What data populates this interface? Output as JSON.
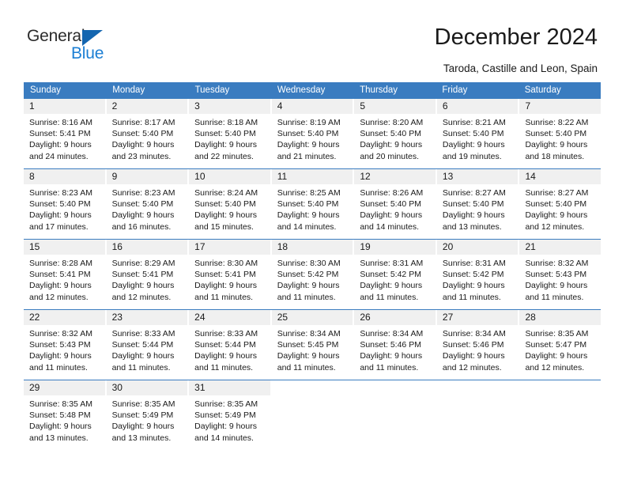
{
  "brand": {
    "name_top": "General",
    "name_bottom": "Blue",
    "accent_color": "#1c7fd4",
    "triangle_color": "#1466b0"
  },
  "header": {
    "title": "December 2024",
    "subtitle": "Taroda, Castille and Leon, Spain"
  },
  "calendar": {
    "header_bg": "#3a7cc0",
    "daynum_bg": "#f0f0f0",
    "weekdays": [
      "Sunday",
      "Monday",
      "Tuesday",
      "Wednesday",
      "Thursday",
      "Friday",
      "Saturday"
    ],
    "weeks": [
      [
        {
          "day": "1",
          "sunrise": "Sunrise: 8:16 AM",
          "sunset": "Sunset: 5:41 PM",
          "daylight1": "Daylight: 9 hours",
          "daylight2": "and 24 minutes."
        },
        {
          "day": "2",
          "sunrise": "Sunrise: 8:17 AM",
          "sunset": "Sunset: 5:40 PM",
          "daylight1": "Daylight: 9 hours",
          "daylight2": "and 23 minutes."
        },
        {
          "day": "3",
          "sunrise": "Sunrise: 8:18 AM",
          "sunset": "Sunset: 5:40 PM",
          "daylight1": "Daylight: 9 hours",
          "daylight2": "and 22 minutes."
        },
        {
          "day": "4",
          "sunrise": "Sunrise: 8:19 AM",
          "sunset": "Sunset: 5:40 PM",
          "daylight1": "Daylight: 9 hours",
          "daylight2": "and 21 minutes."
        },
        {
          "day": "5",
          "sunrise": "Sunrise: 8:20 AM",
          "sunset": "Sunset: 5:40 PM",
          "daylight1": "Daylight: 9 hours",
          "daylight2": "and 20 minutes."
        },
        {
          "day": "6",
          "sunrise": "Sunrise: 8:21 AM",
          "sunset": "Sunset: 5:40 PM",
          "daylight1": "Daylight: 9 hours",
          "daylight2": "and 19 minutes."
        },
        {
          "day": "7",
          "sunrise": "Sunrise: 8:22 AM",
          "sunset": "Sunset: 5:40 PM",
          "daylight1": "Daylight: 9 hours",
          "daylight2": "and 18 minutes."
        }
      ],
      [
        {
          "day": "8",
          "sunrise": "Sunrise: 8:23 AM",
          "sunset": "Sunset: 5:40 PM",
          "daylight1": "Daylight: 9 hours",
          "daylight2": "and 17 minutes."
        },
        {
          "day": "9",
          "sunrise": "Sunrise: 8:23 AM",
          "sunset": "Sunset: 5:40 PM",
          "daylight1": "Daylight: 9 hours",
          "daylight2": "and 16 minutes."
        },
        {
          "day": "10",
          "sunrise": "Sunrise: 8:24 AM",
          "sunset": "Sunset: 5:40 PM",
          "daylight1": "Daylight: 9 hours",
          "daylight2": "and 15 minutes."
        },
        {
          "day": "11",
          "sunrise": "Sunrise: 8:25 AM",
          "sunset": "Sunset: 5:40 PM",
          "daylight1": "Daylight: 9 hours",
          "daylight2": "and 14 minutes."
        },
        {
          "day": "12",
          "sunrise": "Sunrise: 8:26 AM",
          "sunset": "Sunset: 5:40 PM",
          "daylight1": "Daylight: 9 hours",
          "daylight2": "and 14 minutes."
        },
        {
          "day": "13",
          "sunrise": "Sunrise: 8:27 AM",
          "sunset": "Sunset: 5:40 PM",
          "daylight1": "Daylight: 9 hours",
          "daylight2": "and 13 minutes."
        },
        {
          "day": "14",
          "sunrise": "Sunrise: 8:27 AM",
          "sunset": "Sunset: 5:40 PM",
          "daylight1": "Daylight: 9 hours",
          "daylight2": "and 12 minutes."
        }
      ],
      [
        {
          "day": "15",
          "sunrise": "Sunrise: 8:28 AM",
          "sunset": "Sunset: 5:41 PM",
          "daylight1": "Daylight: 9 hours",
          "daylight2": "and 12 minutes."
        },
        {
          "day": "16",
          "sunrise": "Sunrise: 8:29 AM",
          "sunset": "Sunset: 5:41 PM",
          "daylight1": "Daylight: 9 hours",
          "daylight2": "and 12 minutes."
        },
        {
          "day": "17",
          "sunrise": "Sunrise: 8:30 AM",
          "sunset": "Sunset: 5:41 PM",
          "daylight1": "Daylight: 9 hours",
          "daylight2": "and 11 minutes."
        },
        {
          "day": "18",
          "sunrise": "Sunrise: 8:30 AM",
          "sunset": "Sunset: 5:42 PM",
          "daylight1": "Daylight: 9 hours",
          "daylight2": "and 11 minutes."
        },
        {
          "day": "19",
          "sunrise": "Sunrise: 8:31 AM",
          "sunset": "Sunset: 5:42 PM",
          "daylight1": "Daylight: 9 hours",
          "daylight2": "and 11 minutes."
        },
        {
          "day": "20",
          "sunrise": "Sunrise: 8:31 AM",
          "sunset": "Sunset: 5:42 PM",
          "daylight1": "Daylight: 9 hours",
          "daylight2": "and 11 minutes."
        },
        {
          "day": "21",
          "sunrise": "Sunrise: 8:32 AM",
          "sunset": "Sunset: 5:43 PM",
          "daylight1": "Daylight: 9 hours",
          "daylight2": "and 11 minutes."
        }
      ],
      [
        {
          "day": "22",
          "sunrise": "Sunrise: 8:32 AM",
          "sunset": "Sunset: 5:43 PM",
          "daylight1": "Daylight: 9 hours",
          "daylight2": "and 11 minutes."
        },
        {
          "day": "23",
          "sunrise": "Sunrise: 8:33 AM",
          "sunset": "Sunset: 5:44 PM",
          "daylight1": "Daylight: 9 hours",
          "daylight2": "and 11 minutes."
        },
        {
          "day": "24",
          "sunrise": "Sunrise: 8:33 AM",
          "sunset": "Sunset: 5:44 PM",
          "daylight1": "Daylight: 9 hours",
          "daylight2": "and 11 minutes."
        },
        {
          "day": "25",
          "sunrise": "Sunrise: 8:34 AM",
          "sunset": "Sunset: 5:45 PM",
          "daylight1": "Daylight: 9 hours",
          "daylight2": "and 11 minutes."
        },
        {
          "day": "26",
          "sunrise": "Sunrise: 8:34 AM",
          "sunset": "Sunset: 5:46 PM",
          "daylight1": "Daylight: 9 hours",
          "daylight2": "and 11 minutes."
        },
        {
          "day": "27",
          "sunrise": "Sunrise: 8:34 AM",
          "sunset": "Sunset: 5:46 PM",
          "daylight1": "Daylight: 9 hours",
          "daylight2": "and 12 minutes."
        },
        {
          "day": "28",
          "sunrise": "Sunrise: 8:35 AM",
          "sunset": "Sunset: 5:47 PM",
          "daylight1": "Daylight: 9 hours",
          "daylight2": "and 12 minutes."
        }
      ],
      [
        {
          "day": "29",
          "sunrise": "Sunrise: 8:35 AM",
          "sunset": "Sunset: 5:48 PM",
          "daylight1": "Daylight: 9 hours",
          "daylight2": "and 13 minutes."
        },
        {
          "day": "30",
          "sunrise": "Sunrise: 8:35 AM",
          "sunset": "Sunset: 5:49 PM",
          "daylight1": "Daylight: 9 hours",
          "daylight2": "and 13 minutes."
        },
        {
          "day": "31",
          "sunrise": "Sunrise: 8:35 AM",
          "sunset": "Sunset: 5:49 PM",
          "daylight1": "Daylight: 9 hours",
          "daylight2": "and 14 minutes."
        },
        {
          "day": "",
          "sunrise": "",
          "sunset": "",
          "daylight1": "",
          "daylight2": ""
        },
        {
          "day": "",
          "sunrise": "",
          "sunset": "",
          "daylight1": "",
          "daylight2": ""
        },
        {
          "day": "",
          "sunrise": "",
          "sunset": "",
          "daylight1": "",
          "daylight2": ""
        },
        {
          "day": "",
          "sunrise": "",
          "sunset": "",
          "daylight1": "",
          "daylight2": ""
        }
      ]
    ]
  }
}
